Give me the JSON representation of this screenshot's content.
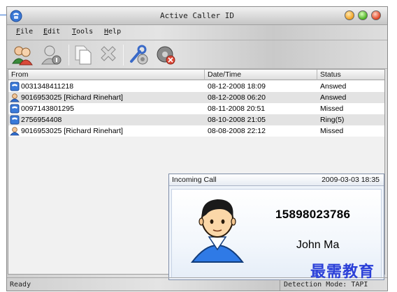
{
  "window": {
    "title": "Active Caller ID"
  },
  "menu": {
    "items": [
      {
        "mnemonic": "F",
        "rest": "ile"
      },
      {
        "mnemonic": "E",
        "rest": "dit"
      },
      {
        "mnemonic": "T",
        "rest": "ools"
      },
      {
        "mnemonic": "H",
        "rest": "elp"
      }
    ]
  },
  "toolbar": {
    "buttons": [
      "contacts-icon",
      "user-info-icon",
      "copy-icon",
      "delete-icon",
      "settings-icon",
      "disconnect-icon"
    ]
  },
  "list": {
    "columns": [
      "From",
      "Date/Time",
      "Status"
    ],
    "rows": [
      {
        "from": "0031348411218",
        "datetime": "08-12-2008 18:09",
        "status": "Answed",
        "icon": "phone-book-icon"
      },
      {
        "from": "9016953025 [Richard Rinehart]",
        "datetime": "08-12-2008 06:20",
        "status": "Answed",
        "icon": "contact-icon"
      },
      {
        "from": "0097143801295",
        "datetime": "08-11-2008 20:51",
        "status": "Missed",
        "icon": "phone-book-icon"
      },
      {
        "from": "2756954408",
        "datetime": "08-10-2008 21:05",
        "status": "Ring(5)",
        "icon": "phone-book-icon"
      },
      {
        "from": "9016953025 [Richard Rinehart]",
        "datetime": "08-08-2008 22:12",
        "status": "Missed",
        "icon": "contact-icon"
      }
    ]
  },
  "popup": {
    "title": "Incoming Call",
    "time": "2009-03-03 18:35",
    "number": "15898023786",
    "name": "John Ma"
  },
  "status": {
    "left": "Ready",
    "right": "Detection Mode: TAPI"
  },
  "watermark": "最需教育",
  "colors": {
    "popup_border": "#7e8da8",
    "watermark": "#2a3fd8",
    "accent_blue": "#2f6fd0"
  }
}
